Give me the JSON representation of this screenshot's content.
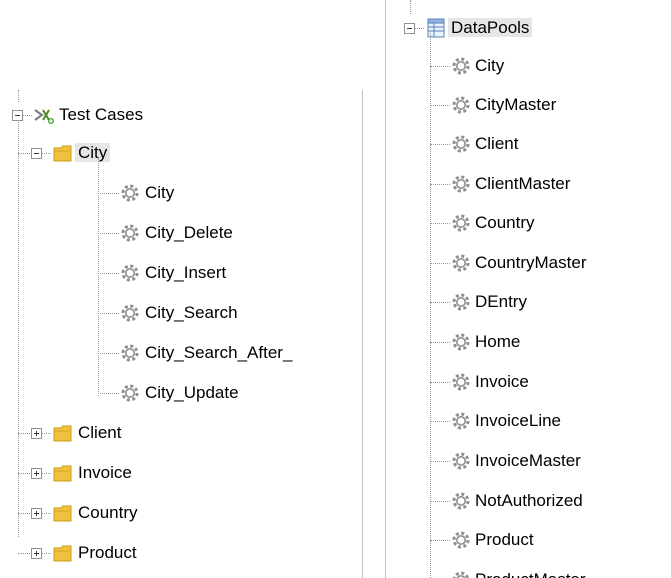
{
  "left_tree": {
    "root": {
      "label": "Test Cases",
      "icon": "test-cases-icon",
      "expanded": true
    },
    "folders": [
      {
        "label": "City",
        "icon": "folder-icon",
        "expanded": true,
        "selected": true,
        "children": [
          "City",
          "City_Delete",
          "City_Insert",
          "City_Search",
          "City_Search_After_",
          "City_Update"
        ]
      },
      {
        "label": "Client",
        "icon": "folder-icon",
        "expanded": false
      },
      {
        "label": "Invoice",
        "icon": "folder-icon",
        "expanded": false
      },
      {
        "label": "Country",
        "icon": "folder-icon",
        "expanded": false
      },
      {
        "label": "Product",
        "icon": "folder-icon",
        "expanded": false
      }
    ],
    "child_icon": "gear-icon"
  },
  "right_tree": {
    "root": {
      "label": "DataPools",
      "icon": "datapool-icon",
      "expanded": true,
      "selected": true
    },
    "child_icon": "gear-icon",
    "items": [
      "City",
      "CityMaster",
      "Client",
      "ClientMaster",
      "Country",
      "CountryMaster",
      "DEntry",
      "Home",
      "Invoice",
      "InvoiceLine",
      "InvoiceMaster",
      "NotAuthorized",
      "Product",
      "ProductMaster"
    ]
  },
  "colors": {
    "background": "#ffffff",
    "selection": "#e6e6e6",
    "tree_line": "#9a9a9a",
    "folder": "#f0c13c",
    "gear": "#8f8f8f"
  }
}
